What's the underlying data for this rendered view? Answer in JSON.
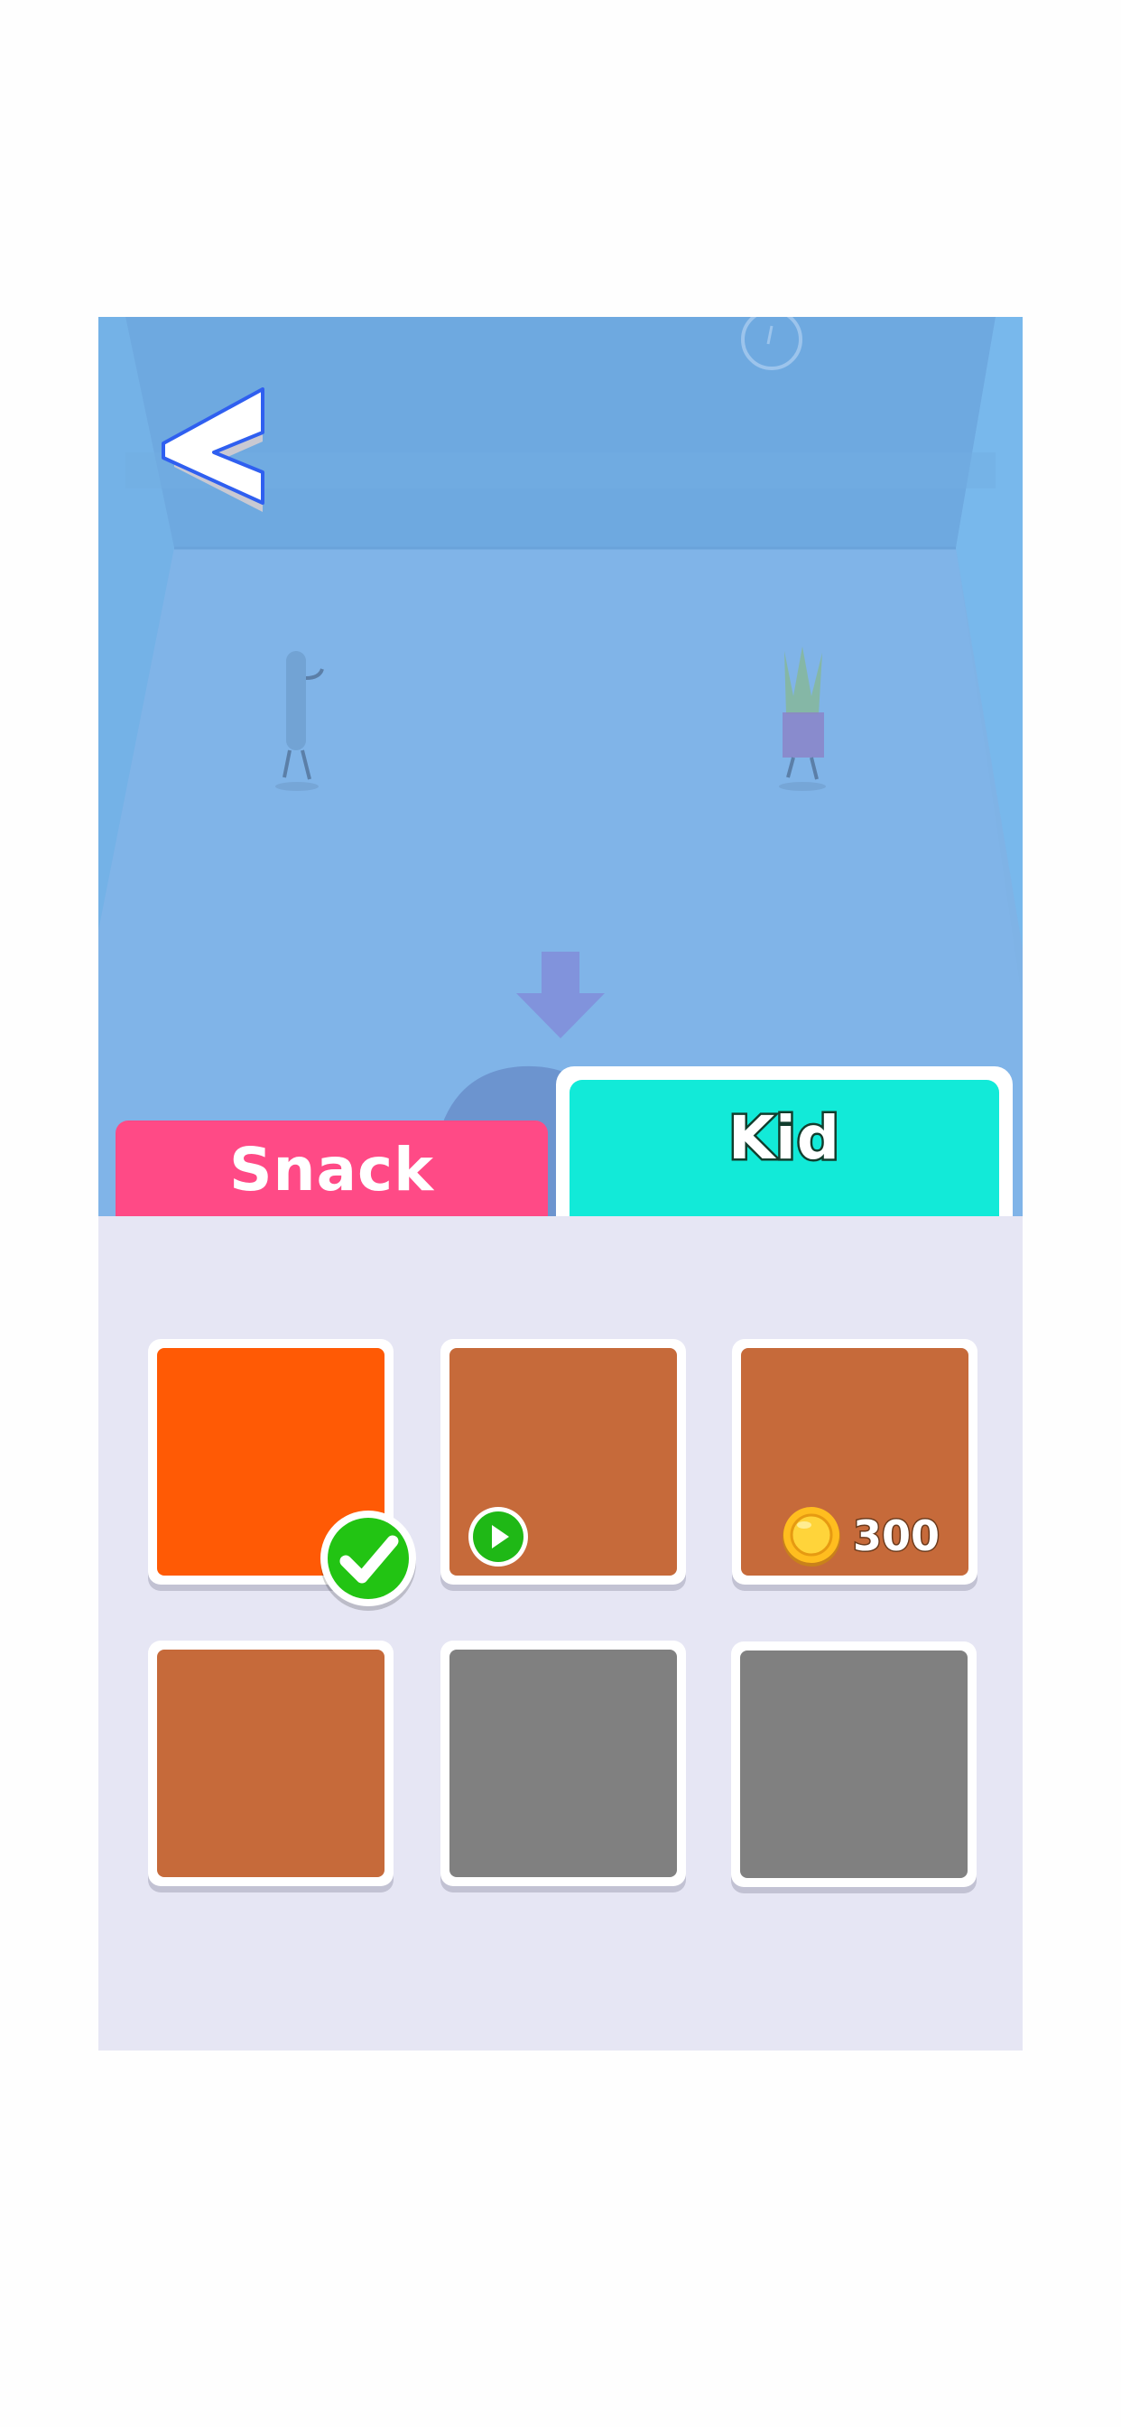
{
  "tabs": [
    {
      "label": "Snack",
      "color": "#ff4a86",
      "active": false
    },
    {
      "label": "Kid",
      "color": "#12ead8",
      "active": true
    }
  ],
  "skins": [
    {
      "color": "#ff5a05",
      "state": "selected"
    },
    {
      "color": "#c66a3a",
      "state": "watch-ad"
    },
    {
      "color": "#c66a3a",
      "state": "buy",
      "price": "300"
    },
    {
      "color": "#c66a3a",
      "state": "available"
    },
    {
      "color": "#808080",
      "state": "locked"
    },
    {
      "color": "#808080",
      "state": "locked"
    }
  ],
  "icons": {
    "back": "back-chevron-icon",
    "drop": "down-arrow-icon",
    "selected": "checkmark-icon",
    "ad": "play-icon",
    "currency": "coin-icon"
  },
  "colors": {
    "scene_bg": "#7fb3e6",
    "panel_bg": "#e6e6f4",
    "back_outline": "#2f5ff0"
  }
}
